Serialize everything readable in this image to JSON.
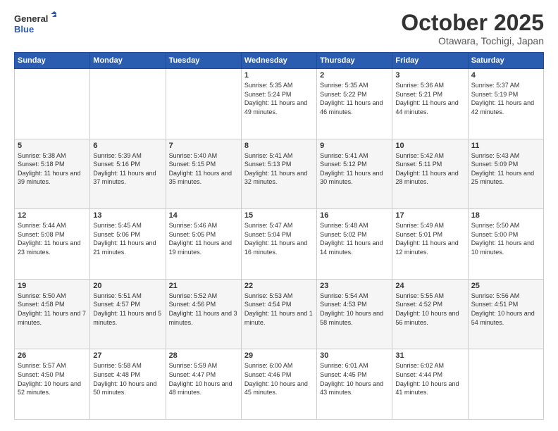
{
  "header": {
    "logo_line1": "General",
    "logo_line2": "Blue",
    "month": "October 2025",
    "location": "Otawara, Tochigi, Japan"
  },
  "days_of_week": [
    "Sunday",
    "Monday",
    "Tuesday",
    "Wednesday",
    "Thursday",
    "Friday",
    "Saturday"
  ],
  "rows": [
    [
      {
        "day": "",
        "sunrise": "",
        "sunset": "",
        "daylight": ""
      },
      {
        "day": "",
        "sunrise": "",
        "sunset": "",
        "daylight": ""
      },
      {
        "day": "",
        "sunrise": "",
        "sunset": "",
        "daylight": ""
      },
      {
        "day": "1",
        "sunrise": "Sunrise: 5:35 AM",
        "sunset": "Sunset: 5:24 PM",
        "daylight": "Daylight: 11 hours and 49 minutes."
      },
      {
        "day": "2",
        "sunrise": "Sunrise: 5:35 AM",
        "sunset": "Sunset: 5:22 PM",
        "daylight": "Daylight: 11 hours and 46 minutes."
      },
      {
        "day": "3",
        "sunrise": "Sunrise: 5:36 AM",
        "sunset": "Sunset: 5:21 PM",
        "daylight": "Daylight: 11 hours and 44 minutes."
      },
      {
        "day": "4",
        "sunrise": "Sunrise: 5:37 AM",
        "sunset": "Sunset: 5:19 PM",
        "daylight": "Daylight: 11 hours and 42 minutes."
      }
    ],
    [
      {
        "day": "5",
        "sunrise": "Sunrise: 5:38 AM",
        "sunset": "Sunset: 5:18 PM",
        "daylight": "Daylight: 11 hours and 39 minutes."
      },
      {
        "day": "6",
        "sunrise": "Sunrise: 5:39 AM",
        "sunset": "Sunset: 5:16 PM",
        "daylight": "Daylight: 11 hours and 37 minutes."
      },
      {
        "day": "7",
        "sunrise": "Sunrise: 5:40 AM",
        "sunset": "Sunset: 5:15 PM",
        "daylight": "Daylight: 11 hours and 35 minutes."
      },
      {
        "day": "8",
        "sunrise": "Sunrise: 5:41 AM",
        "sunset": "Sunset: 5:13 PM",
        "daylight": "Daylight: 11 hours and 32 minutes."
      },
      {
        "day": "9",
        "sunrise": "Sunrise: 5:41 AM",
        "sunset": "Sunset: 5:12 PM",
        "daylight": "Daylight: 11 hours and 30 minutes."
      },
      {
        "day": "10",
        "sunrise": "Sunrise: 5:42 AM",
        "sunset": "Sunset: 5:11 PM",
        "daylight": "Daylight: 11 hours and 28 minutes."
      },
      {
        "day": "11",
        "sunrise": "Sunrise: 5:43 AM",
        "sunset": "Sunset: 5:09 PM",
        "daylight": "Daylight: 11 hours and 25 minutes."
      }
    ],
    [
      {
        "day": "12",
        "sunrise": "Sunrise: 5:44 AM",
        "sunset": "Sunset: 5:08 PM",
        "daylight": "Daylight: 11 hours and 23 minutes."
      },
      {
        "day": "13",
        "sunrise": "Sunrise: 5:45 AM",
        "sunset": "Sunset: 5:06 PM",
        "daylight": "Daylight: 11 hours and 21 minutes."
      },
      {
        "day": "14",
        "sunrise": "Sunrise: 5:46 AM",
        "sunset": "Sunset: 5:05 PM",
        "daylight": "Daylight: 11 hours and 19 minutes."
      },
      {
        "day": "15",
        "sunrise": "Sunrise: 5:47 AM",
        "sunset": "Sunset: 5:04 PM",
        "daylight": "Daylight: 11 hours and 16 minutes."
      },
      {
        "day": "16",
        "sunrise": "Sunrise: 5:48 AM",
        "sunset": "Sunset: 5:02 PM",
        "daylight": "Daylight: 11 hours and 14 minutes."
      },
      {
        "day": "17",
        "sunrise": "Sunrise: 5:49 AM",
        "sunset": "Sunset: 5:01 PM",
        "daylight": "Daylight: 11 hours and 12 minutes."
      },
      {
        "day": "18",
        "sunrise": "Sunrise: 5:50 AM",
        "sunset": "Sunset: 5:00 PM",
        "daylight": "Daylight: 11 hours and 10 minutes."
      }
    ],
    [
      {
        "day": "19",
        "sunrise": "Sunrise: 5:50 AM",
        "sunset": "Sunset: 4:58 PM",
        "daylight": "Daylight: 11 hours and 7 minutes."
      },
      {
        "day": "20",
        "sunrise": "Sunrise: 5:51 AM",
        "sunset": "Sunset: 4:57 PM",
        "daylight": "Daylight: 11 hours and 5 minutes."
      },
      {
        "day": "21",
        "sunrise": "Sunrise: 5:52 AM",
        "sunset": "Sunset: 4:56 PM",
        "daylight": "Daylight: 11 hours and 3 minutes."
      },
      {
        "day": "22",
        "sunrise": "Sunrise: 5:53 AM",
        "sunset": "Sunset: 4:54 PM",
        "daylight": "Daylight: 11 hours and 1 minute."
      },
      {
        "day": "23",
        "sunrise": "Sunrise: 5:54 AM",
        "sunset": "Sunset: 4:53 PM",
        "daylight": "Daylight: 10 hours and 58 minutes."
      },
      {
        "day": "24",
        "sunrise": "Sunrise: 5:55 AM",
        "sunset": "Sunset: 4:52 PM",
        "daylight": "Daylight: 10 hours and 56 minutes."
      },
      {
        "day": "25",
        "sunrise": "Sunrise: 5:56 AM",
        "sunset": "Sunset: 4:51 PM",
        "daylight": "Daylight: 10 hours and 54 minutes."
      }
    ],
    [
      {
        "day": "26",
        "sunrise": "Sunrise: 5:57 AM",
        "sunset": "Sunset: 4:50 PM",
        "daylight": "Daylight: 10 hours and 52 minutes."
      },
      {
        "day": "27",
        "sunrise": "Sunrise: 5:58 AM",
        "sunset": "Sunset: 4:48 PM",
        "daylight": "Daylight: 10 hours and 50 minutes."
      },
      {
        "day": "28",
        "sunrise": "Sunrise: 5:59 AM",
        "sunset": "Sunset: 4:47 PM",
        "daylight": "Daylight: 10 hours and 48 minutes."
      },
      {
        "day": "29",
        "sunrise": "Sunrise: 6:00 AM",
        "sunset": "Sunset: 4:46 PM",
        "daylight": "Daylight: 10 hours and 45 minutes."
      },
      {
        "day": "30",
        "sunrise": "Sunrise: 6:01 AM",
        "sunset": "Sunset: 4:45 PM",
        "daylight": "Daylight: 10 hours and 43 minutes."
      },
      {
        "day": "31",
        "sunrise": "Sunrise: 6:02 AM",
        "sunset": "Sunset: 4:44 PM",
        "daylight": "Daylight: 10 hours and 41 minutes."
      },
      {
        "day": "",
        "sunrise": "",
        "sunset": "",
        "daylight": ""
      }
    ]
  ]
}
